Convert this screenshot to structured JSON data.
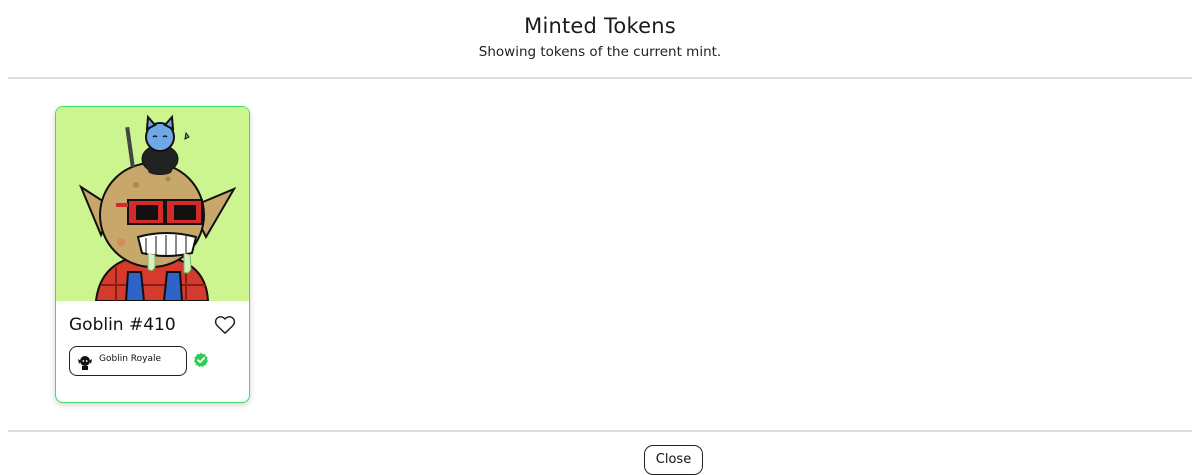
{
  "header": {
    "title": "Minted Tokens",
    "subtitle": "Showing tokens of the current mint."
  },
  "tokens": [
    {
      "name": "Goblin #410",
      "collection": "Goblin Royale",
      "verified": true,
      "image_background": "#cdf58f",
      "image_alt": "goblin-nft-art"
    }
  ],
  "footer": {
    "close_label": "Close"
  },
  "colors": {
    "card_border": "#47d86a",
    "verified_badge": "#2ecc55",
    "divider": "#dcdcdc"
  },
  "icons": {
    "favorite": "heart-icon",
    "verified": "verified-check-icon",
    "collection_avatar": "collection-avatar-icon"
  }
}
